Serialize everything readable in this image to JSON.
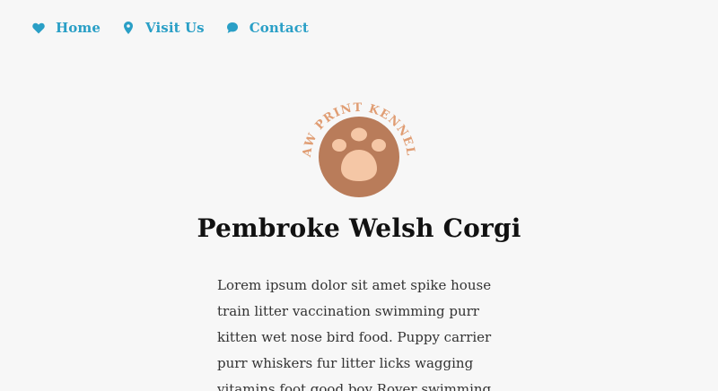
{
  "colors": {
    "accent": "#2a9fc6",
    "logo_circle": "#b97c5a",
    "logo_pad": "#f5c7a6",
    "logo_text": "#e09d73",
    "background": "#f7f7f7"
  },
  "nav": {
    "items": [
      {
        "label": "Home",
        "icon": "heart-icon"
      },
      {
        "label": "Visit Us",
        "icon": "map-pin-icon"
      },
      {
        "label": "Contact",
        "icon": "chat-bubble-icon"
      }
    ]
  },
  "logo": {
    "text": "PAW PRINT KENNELS"
  },
  "main": {
    "title": "Pembroke Welsh Corgi",
    "body": "Lorem ipsum dolor sit amet spike house train litter vaccination swimming purr kitten wet nose bird food. Puppy carrier purr whiskers fur litter licks wagging vitamins foot good boy Rover swimming."
  }
}
